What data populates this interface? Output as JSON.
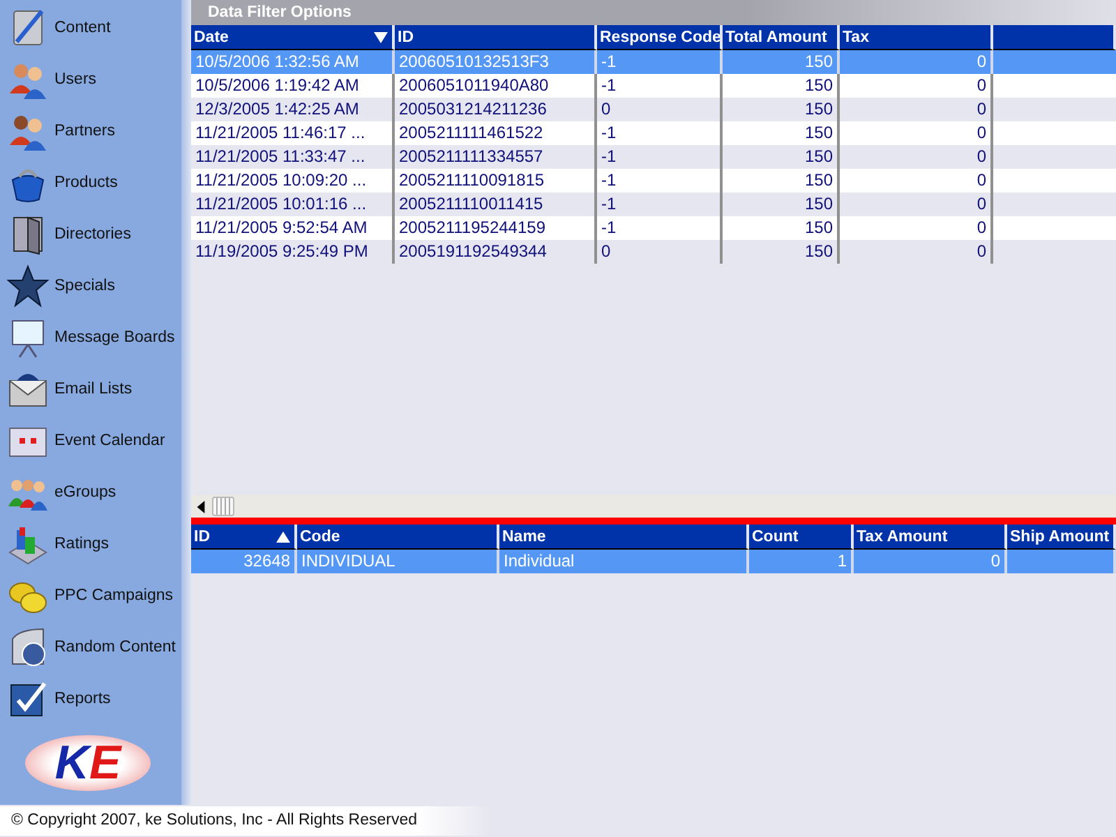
{
  "sidebar": {
    "items": [
      {
        "label": "Content"
      },
      {
        "label": "Users"
      },
      {
        "label": "Partners"
      },
      {
        "label": "Products"
      },
      {
        "label": "Directories"
      },
      {
        "label": "Specials"
      },
      {
        "label": "Message Boards"
      },
      {
        "label": "Email Lists"
      },
      {
        "label": "Event Calendar"
      },
      {
        "label": "eGroups"
      },
      {
        "label": "Ratings"
      },
      {
        "label": "PPC Campaigns"
      },
      {
        "label": "Random Content"
      },
      {
        "label": "Reports"
      }
    ],
    "logo_text": "KE"
  },
  "panel": {
    "title": "Data Filter Options"
  },
  "table": {
    "columns": [
      {
        "label": "Date",
        "sorted": true,
        "descending": true
      },
      {
        "label": "ID",
        "sorted": false
      },
      {
        "label": "Response Code",
        "sorted": false
      },
      {
        "label": "Total Amount",
        "sorted": false
      },
      {
        "label": "Tax",
        "sorted": false
      }
    ],
    "rows": [
      {
        "cells": [
          "10/5/2006 1:32:56 AM",
          "20060510132513F3",
          "-1",
          "150",
          "0"
        ],
        "selected": true
      },
      {
        "cells": [
          "10/5/2006 1:19:42 AM",
          "2006051011940A80",
          "-1",
          "150",
          "0"
        ],
        "selected": false
      },
      {
        "cells": [
          "12/3/2005 1:42:25 AM",
          "2005031214211236",
          "0",
          "150",
          "0"
        ],
        "selected": false
      },
      {
        "cells": [
          "11/21/2005 11:46:17 ...",
          "2005211111461522",
          "-1",
          "150",
          "0"
        ],
        "selected": false
      },
      {
        "cells": [
          "11/21/2005 11:33:47 ...",
          "2005211111334557",
          "-1",
          "150",
          "0"
        ],
        "selected": false
      },
      {
        "cells": [
          "11/21/2005 10:09:20 ...",
          "2005211110091815",
          "-1",
          "150",
          "0"
        ],
        "selected": false
      },
      {
        "cells": [
          "11/21/2005 10:01:16 ...",
          "2005211110011415",
          "-1",
          "150",
          "0"
        ],
        "selected": false
      },
      {
        "cells": [
          "11/21/2005 9:52:54 AM",
          "2005211195244159",
          "-1",
          "150",
          "0"
        ],
        "selected": false
      },
      {
        "cells": [
          "11/19/2005 9:25:49 PM",
          "2005191192549344",
          "0",
          "150",
          "0"
        ],
        "selected": false
      }
    ]
  },
  "detail_table": {
    "columns": [
      {
        "label": "ID",
        "sorted": true,
        "descending": false
      },
      {
        "label": "Code",
        "sorted": false
      },
      {
        "label": "Name",
        "sorted": false
      },
      {
        "label": "Count",
        "sorted": false
      },
      {
        "label": "Tax Amount",
        "sorted": false
      },
      {
        "label": "Ship Amount",
        "sorted": false
      }
    ],
    "rows": [
      {
        "cells": [
          "32648",
          "INDIVIDUAL",
          "Individual",
          "1",
          "0",
          ""
        ],
        "selected": true
      }
    ]
  },
  "status_bar": {
    "copyright": "© Copyright 2007, ke Solutions, Inc - All Rights Reserved"
  }
}
